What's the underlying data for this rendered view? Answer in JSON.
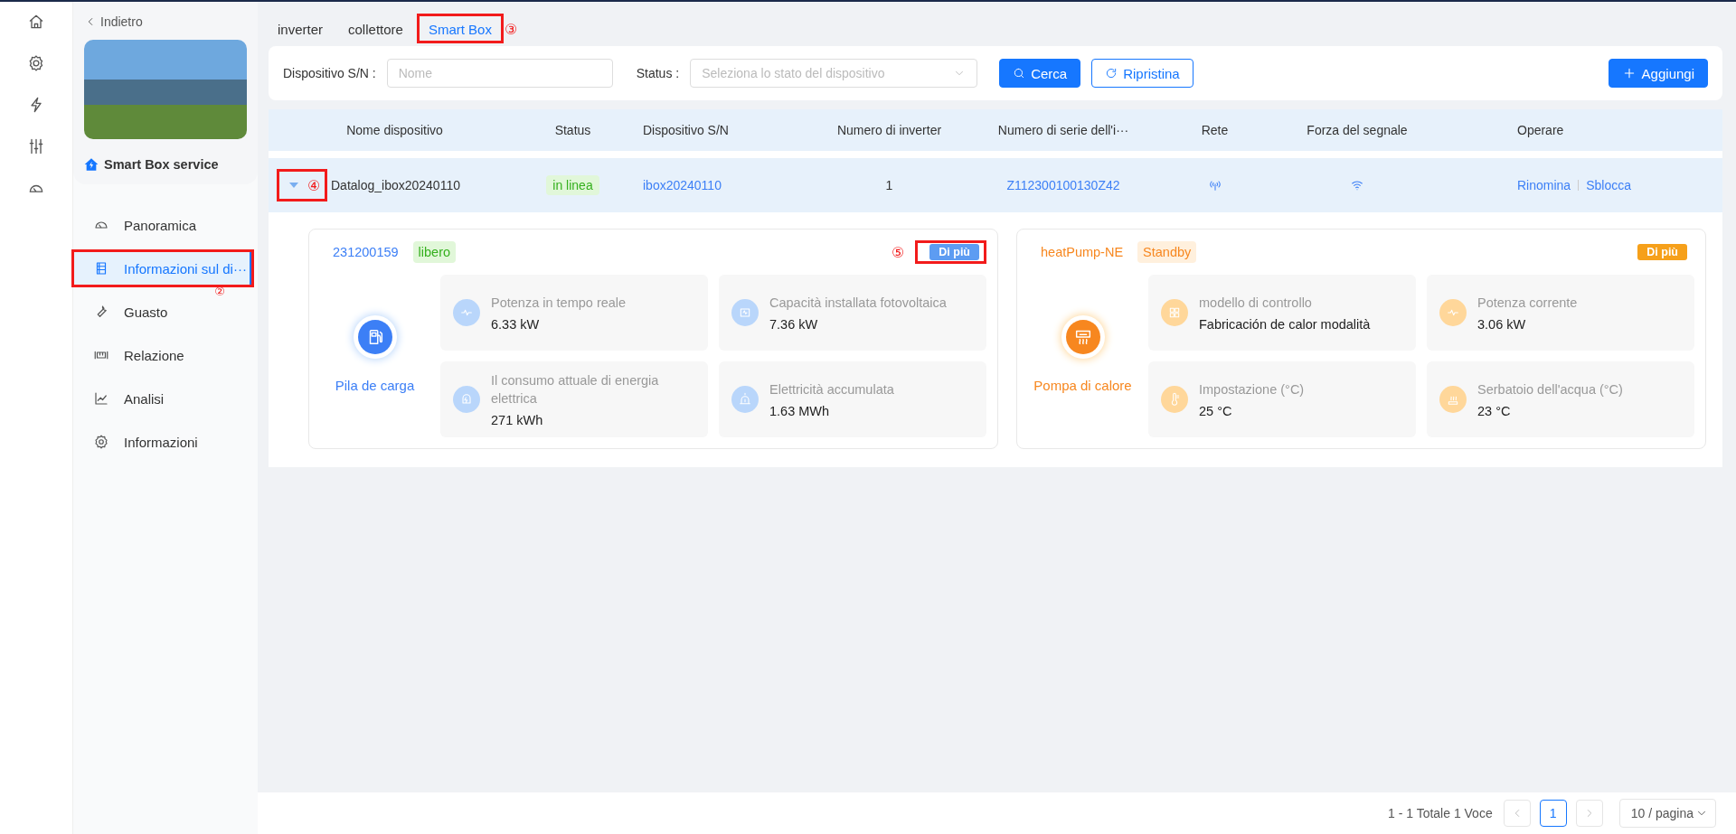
{
  "sidebar": {
    "back": "Indietro",
    "title": "Smart Box service",
    "items": [
      {
        "label": "Panoramica",
        "selected": false
      },
      {
        "label": "Informazioni sul di···",
        "selected": true,
        "callout": "②"
      },
      {
        "label": "Guasto",
        "selected": false
      },
      {
        "label": "Relazione",
        "selected": false
      },
      {
        "label": "Analisi",
        "selected": false
      },
      {
        "label": "Informazioni",
        "selected": false
      }
    ]
  },
  "tabs": [
    {
      "label": "inverter",
      "selected": false
    },
    {
      "label": "collettore",
      "selected": false
    },
    {
      "label": "Smart Box",
      "selected": true,
      "callout": "③"
    }
  ],
  "filters": {
    "sn_label": "Dispositivo S/N :",
    "sn_placeholder": "Nome",
    "status_label": "Status :",
    "status_placeholder": "Seleziona lo stato del dispositivo",
    "search": "Cerca",
    "reset": "Ripristina",
    "add": "Aggiungi"
  },
  "table": {
    "columns": [
      "Nome dispositivo",
      "Status",
      "Dispositivo S/N",
      "Numero di inverter",
      "Numero di serie dell'i···",
      "Rete",
      "Forza del segnale",
      "Operare"
    ],
    "rows": [
      {
        "expanded": true,
        "callout": "④",
        "name": "Datalog_ibox20240110",
        "status": "in linea",
        "sn": "ibox20240110",
        "inverters": "1",
        "serial": "Z112300100130Z42",
        "actions": [
          "Rinomina",
          "Sblocca"
        ],
        "cards": [
          {
            "kind": "charger",
            "color": "#3c7ff6",
            "id": "231200159",
            "state": "libero",
            "title": "Pila de carga",
            "more": "Di più",
            "callout": "⑤",
            "metrics": [
              {
                "label": "Potenza in tempo reale",
                "value": "6.33 kW"
              },
              {
                "label": "Capacità installata fotovoltaica",
                "value": "7.36 kW"
              },
              {
                "label": "Il consumo attuale di energia elettrica",
                "value": "271 kWh"
              },
              {
                "label": "Elettricità accumulata",
                "value": "1.63 MWh"
              }
            ]
          },
          {
            "kind": "heatpump",
            "color": "#f7871f",
            "id": "heatPump-NE",
            "state": "Standby",
            "title": "Pompa di calore",
            "more": "Di più",
            "metrics": [
              {
                "label": "modello di controllo",
                "value": "Fabricación de calor modalità"
              },
              {
                "label": "Potenza corrente",
                "value": "3.06 kW"
              },
              {
                "label": "Impostazione (°C)",
                "value": "25 °C"
              },
              {
                "label": "Serbatoio dell'acqua (°C)",
                "value": "23 °C"
              }
            ]
          }
        ]
      }
    ]
  },
  "pagination": {
    "summary": "1 - 1 Totale 1 Voce",
    "pages": [
      {
        "label": "1",
        "selected": true
      }
    ],
    "page_size": "10 / pagina"
  }
}
